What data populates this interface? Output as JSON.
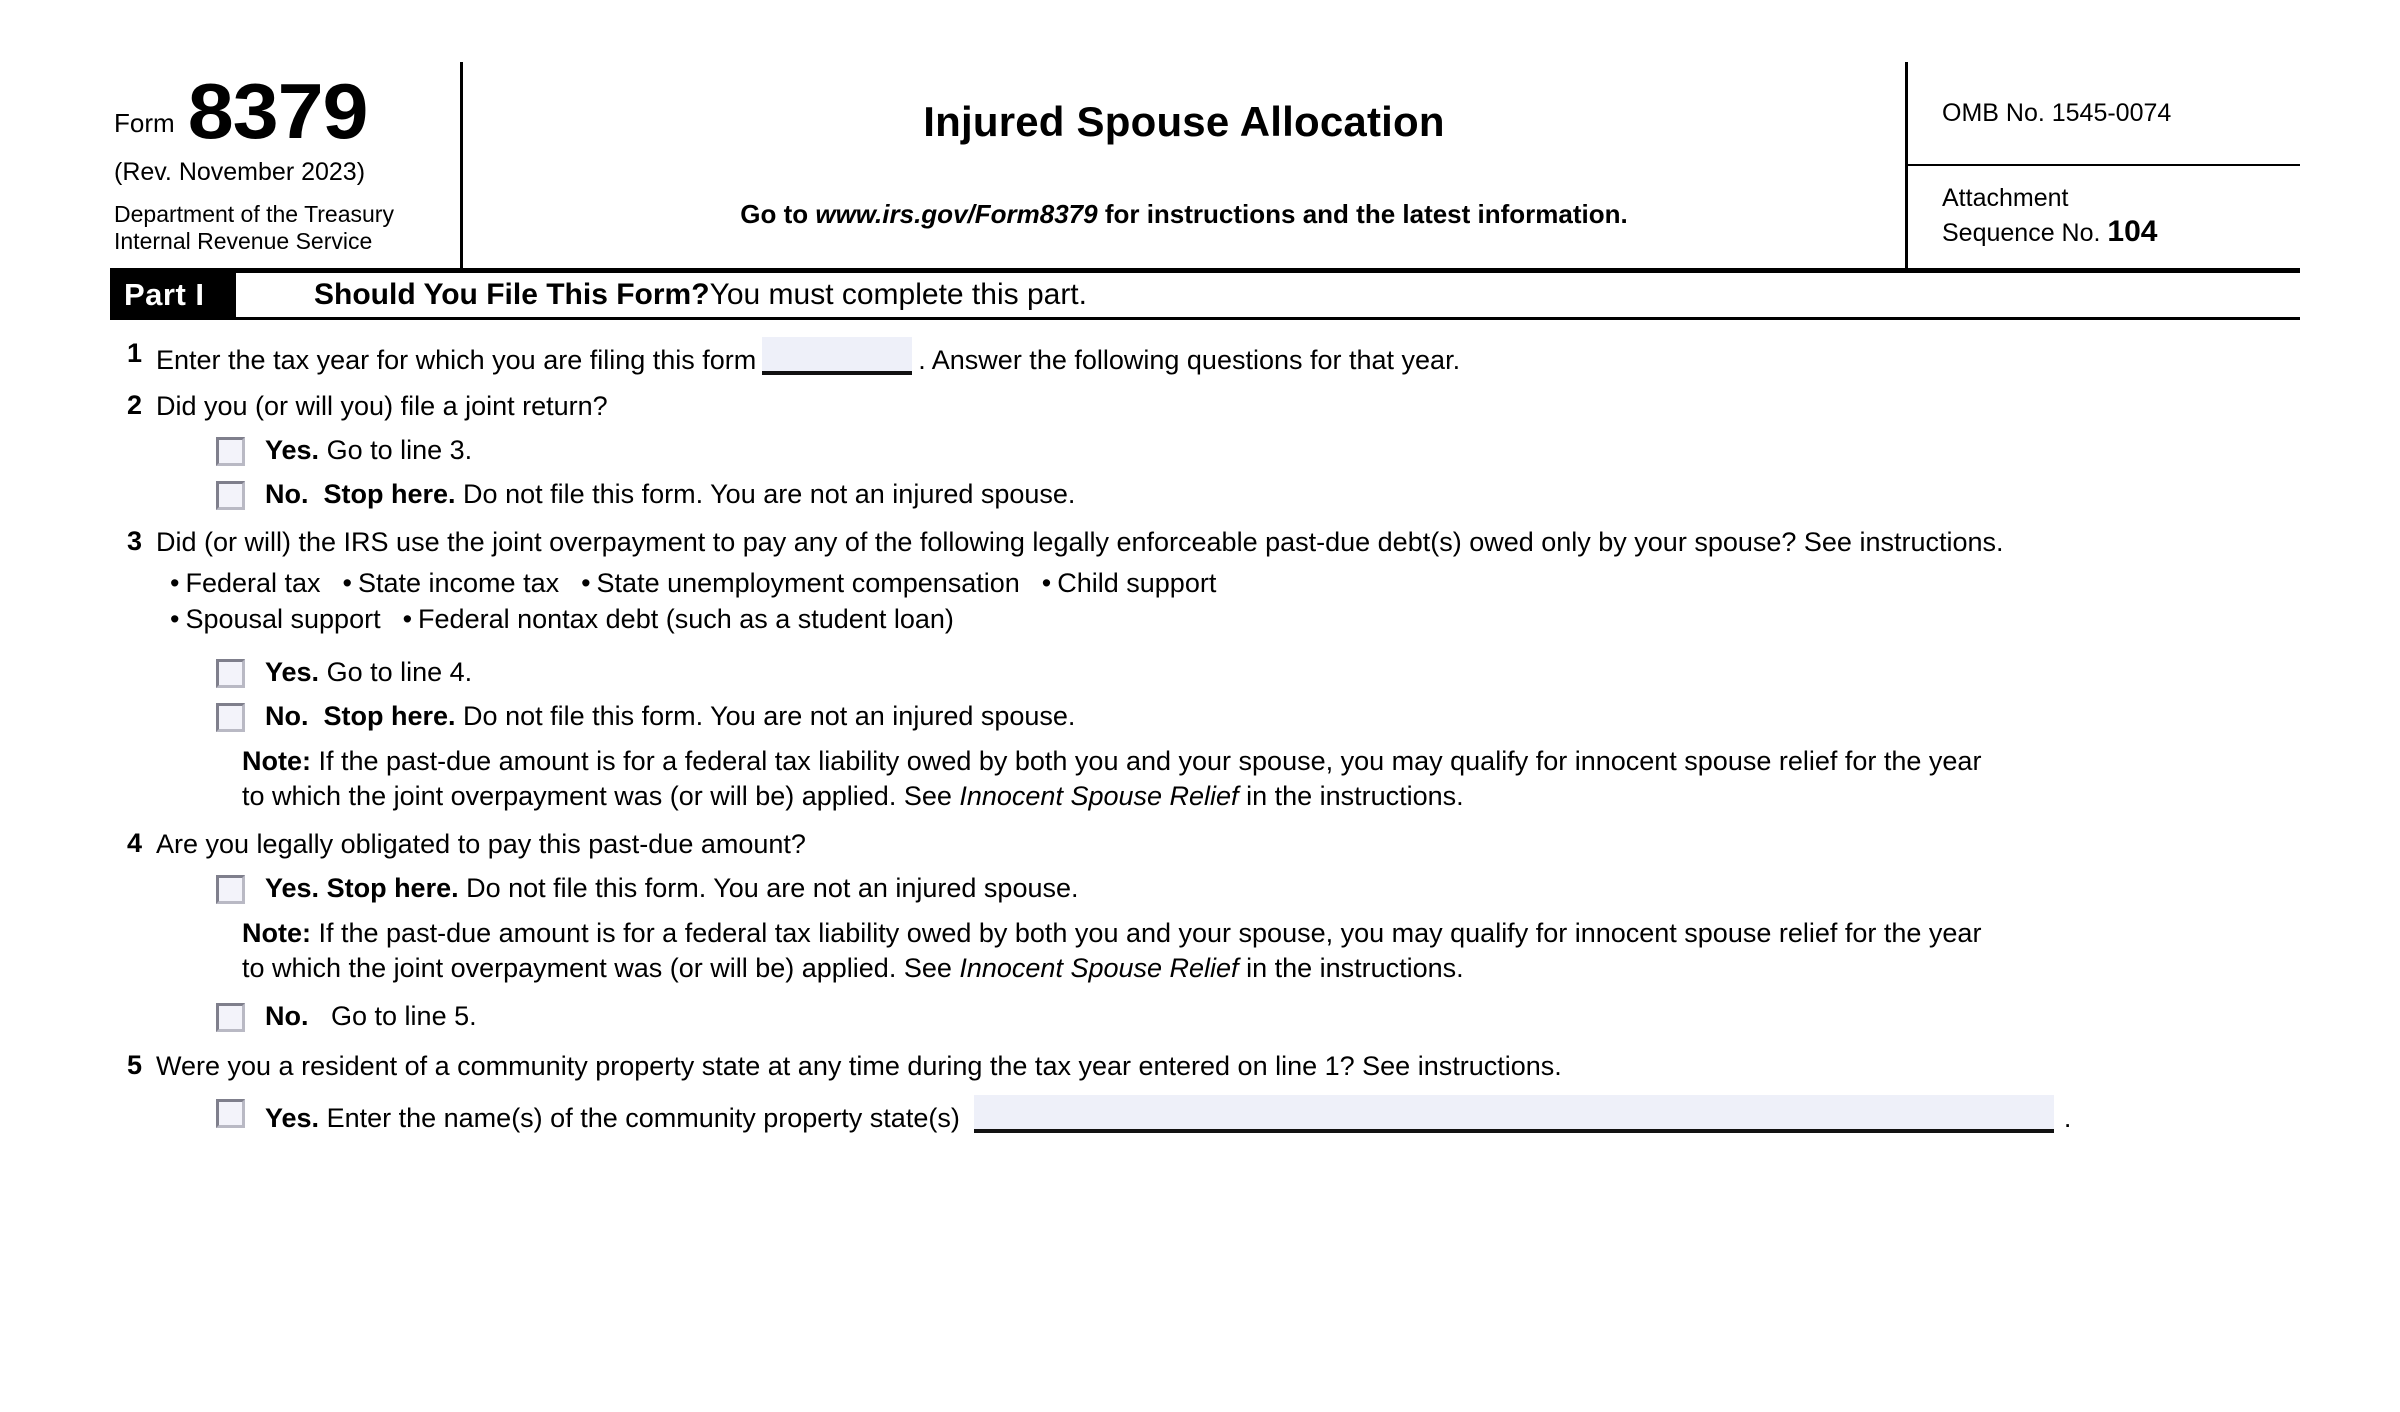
{
  "header": {
    "form_word": "Form",
    "form_number": "8379",
    "revision": "(Rev. November 2023)",
    "department_line1": "Department of the Treasury",
    "department_line2": "Internal Revenue Service",
    "title": "Injured Spouse Allocation",
    "goto_prefix": "Go to ",
    "goto_url": "www.irs.gov/Form8379",
    "goto_suffix": " for instructions and the latest information.",
    "omb": "OMB No. 1545-0074",
    "attachment_label_line1": "Attachment",
    "attachment_label_line2": "Sequence No.",
    "attachment_number": "104"
  },
  "part": {
    "tag": "Part I",
    "heading_bold": "Should You File This Form?",
    "heading_normal": " You must complete this part."
  },
  "lines": {
    "l1": {
      "num": "1",
      "text_before": "Enter the tax year for which you are filing this form",
      "field_value": "",
      "text_after": ". Answer the following questions for that year."
    },
    "l2": {
      "num": "2",
      "question": "Did you (or will you) file a joint return?",
      "yes_bold": "Yes.",
      "yes_rest": " Go to line 3.",
      "no_bold": "No.",
      "no_bold2": "Stop here.",
      "no_rest": " Do not file this form. You are not an injured spouse."
    },
    "l3": {
      "num": "3",
      "question": "Did (or will) the IRS use the joint overpayment to pay any of the following legally enforceable past-due debt(s) owed only by your spouse? See instructions.",
      "bullets_row1": [
        "Federal tax",
        "State income tax",
        "State unemployment compensation",
        "Child support"
      ],
      "bullets_row2": [
        "Spousal support",
        "Federal nontax debt (such as a student loan)"
      ],
      "yes_bold": "Yes.",
      "yes_rest": " Go to line 4.",
      "no_bold": "No.",
      "no_bold2": "Stop here.",
      "no_rest": " Do not file this form. You are not an injured spouse.",
      "note_label": "Note:",
      "note_part1": " If the past-due amount is for a federal tax liability owed by both you and your spouse, you may qualify for innocent spouse relief for the year to which the joint overpayment was (or will be) applied. See ",
      "note_italic": "Innocent Spouse Relief",
      "note_part2": " in the instructions."
    },
    "l4": {
      "num": "4",
      "question": "Are you legally obligated to pay this past-due amount?",
      "yes_bold": "Yes.",
      "yes_bold2": "Stop here.",
      "yes_rest": " Do not file this form. You are not an injured spouse.",
      "note_label": "Note:",
      "note_part1": " If the past-due amount is for a federal tax liability owed by both you and your spouse, you may qualify for innocent spouse relief for the year to which the joint overpayment was (or will be) applied. See ",
      "note_italic": "Innocent Spouse Relief",
      "note_part2": " in the instructions.",
      "no_bold": "No.",
      "no_rest": " Go to line 5."
    },
    "l5": {
      "num": "5",
      "question": "Were you a resident of a community property state at any time during the tax year entered on line 1? See instructions.",
      "yes_bold": "Yes.",
      "yes_rest": "Enter the name(s) of the community property state(s)",
      "field_value": "",
      "trailing": "."
    }
  },
  "colors": {
    "field_fill": "#eef0f9",
    "checkbox_fill": "#f3f3fa",
    "rule": "#000000"
  }
}
